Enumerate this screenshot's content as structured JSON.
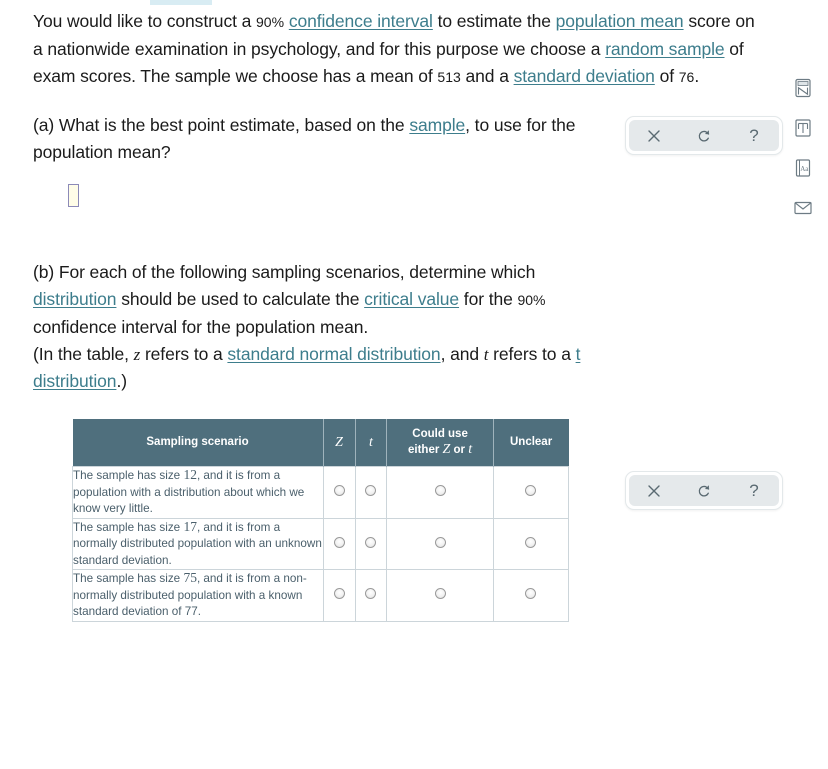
{
  "problem": {
    "intro": {
      "s1": "You would like to construct a ",
      "pct": "90%",
      "link_ci": "confidence interval",
      "s2": " to estimate the ",
      "link_popmean": "population mean",
      "s3": " score on a nationwide examination in psychology, and for this purpose we choose a ",
      "link_random_sample": "random sample",
      "s4": " of exam scores. The sample we choose has a mean of ",
      "mean": "513",
      "s5": " and a ",
      "link_sd": "standard deviation",
      "s6": " of ",
      "sd": "76",
      "s7": "."
    },
    "part_a": {
      "s1": "(a) What is the best point estimate, based on the ",
      "link_sample": "sample",
      "s2": ", to use for the population mean?",
      "answer_value": ""
    },
    "part_b": {
      "s1": "(b) For each of the following sampling scenarios, determine which ",
      "link_distribution": "distribution",
      "s2": " should be used to calculate the ",
      "link_critical_value": "critical value",
      "s3": " for the ",
      "pct": "90%",
      "s4": " confidence interval for the population mean.",
      "note_s1": "(In the table, ",
      "note_z": "z",
      "note_s2": " refers to a ",
      "link_snd": "standard normal distribution",
      "note_s3": ", and ",
      "note_t": "t",
      "note_s4": " refers to a ",
      "link_td": "t distribution",
      "note_s5": ".)"
    }
  },
  "table": {
    "headers": {
      "scenario": "Sampling scenario",
      "z": "Z",
      "t": "t",
      "either_l1": "Could use",
      "either_l2a": "either ",
      "either_z": "Z",
      "either_or": " or ",
      "either_t": "t",
      "unclear": "Unclear"
    },
    "rows": [
      {
        "text_pre": "The sample has size ",
        "size": "12",
        "text_post": ", and it is from a population with a distribution about which we know very little.",
        "options": [
          "z",
          "t",
          "either",
          "unclear"
        ],
        "selected": null
      },
      {
        "text_pre": "The sample has size ",
        "size": "17",
        "text_post": ", and it is from a normally distributed population with an unknown standard deviation.",
        "options": [
          "z",
          "t",
          "either",
          "unclear"
        ],
        "selected": null
      },
      {
        "text_pre": "The sample has size ",
        "size": "75",
        "text_post": ", and it is from a non-normally distributed population with a known standard deviation of 77.",
        "options": [
          "z",
          "t",
          "either",
          "unclear"
        ],
        "selected": null
      }
    ]
  },
  "toolbar": {
    "clear_label": "×",
    "undo_label": "↺",
    "help_label": "?",
    "clear_name": "Clear",
    "undo_name": "Undo",
    "help_name": "Explanation"
  },
  "icon_rail": [
    {
      "icon": "calculator-icon"
    },
    {
      "icon": "book-icon"
    },
    {
      "icon": "reference-aa-icon"
    },
    {
      "icon": "mail-icon"
    }
  ],
  "colors": {
    "link": "#3d7d8c",
    "table_header_bg": "#4f6f7d",
    "table_text": "#4a5f6b",
    "answer_box_border": "#8c8ab8",
    "answer_box_fill": "#fffde8"
  }
}
